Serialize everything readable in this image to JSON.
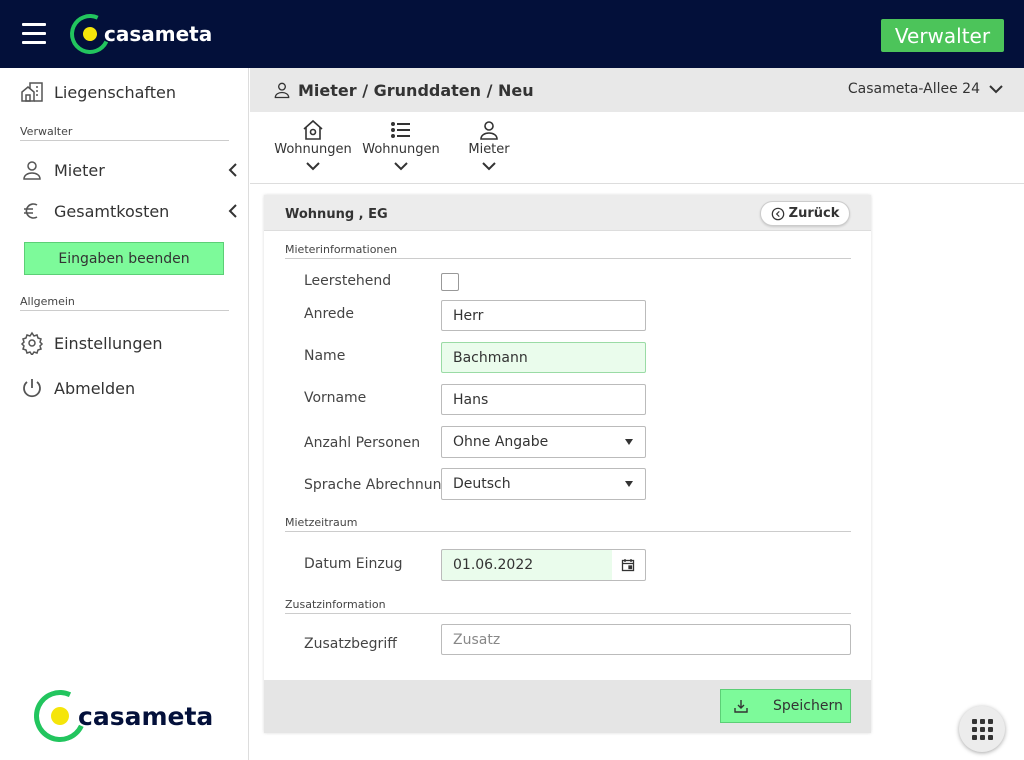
{
  "app": {
    "brand": "casameta",
    "role_button": "Verwalter"
  },
  "sidebar": {
    "items": [
      {
        "label": "Liegenschaften",
        "icon": "building-icon"
      },
      {
        "label": "Mieter",
        "icon": "user-icon"
      },
      {
        "label": "Gesamtkosten",
        "icon": "euro-icon"
      },
      {
        "label": "Einstellungen",
        "icon": "gear-icon"
      },
      {
        "label": "Abmelden",
        "icon": "power-icon"
      }
    ],
    "sections": {
      "verwalter": "Verwalter",
      "allgemein": "Allgemein"
    },
    "finish_button": "Eingaben beenden"
  },
  "header": {
    "title": "Mieter / Grunddaten / Neu",
    "address": "Casameta-Allee 24"
  },
  "toolbar": {
    "items": [
      {
        "label": "Wohnungen",
        "icon": "house-gear-icon"
      },
      {
        "label": "Wohnungen",
        "icon": "list-icon"
      },
      {
        "label": "Mieter",
        "icon": "user-icon"
      }
    ]
  },
  "form": {
    "title": "Wohnung , EG",
    "back_label": "Zurück",
    "sections": {
      "mieter": "Mieterinformationen",
      "miete": "Mietzeitraum",
      "zusatz": "Zusatzinformation"
    },
    "labels": {
      "leerstehend": "Leerstehend",
      "anrede": "Anrede",
      "name": "Name",
      "vorname": "Vorname",
      "anzahl": "Anzahl Personen",
      "sprache": "Sprache Abrechnung",
      "einzug": "Datum Einzug",
      "zusatz": "Zusatzbegriff"
    },
    "values": {
      "leerstehend_checked": false,
      "anrede": "Herr",
      "name": "Bachmann",
      "vorname": "Hans",
      "anzahl": "Ohne Angabe",
      "sprache": "Deutsch",
      "einzug": "01.06.2022"
    },
    "placeholders": {
      "zusatz": "Zusatz"
    },
    "save_label": "Speichern"
  }
}
